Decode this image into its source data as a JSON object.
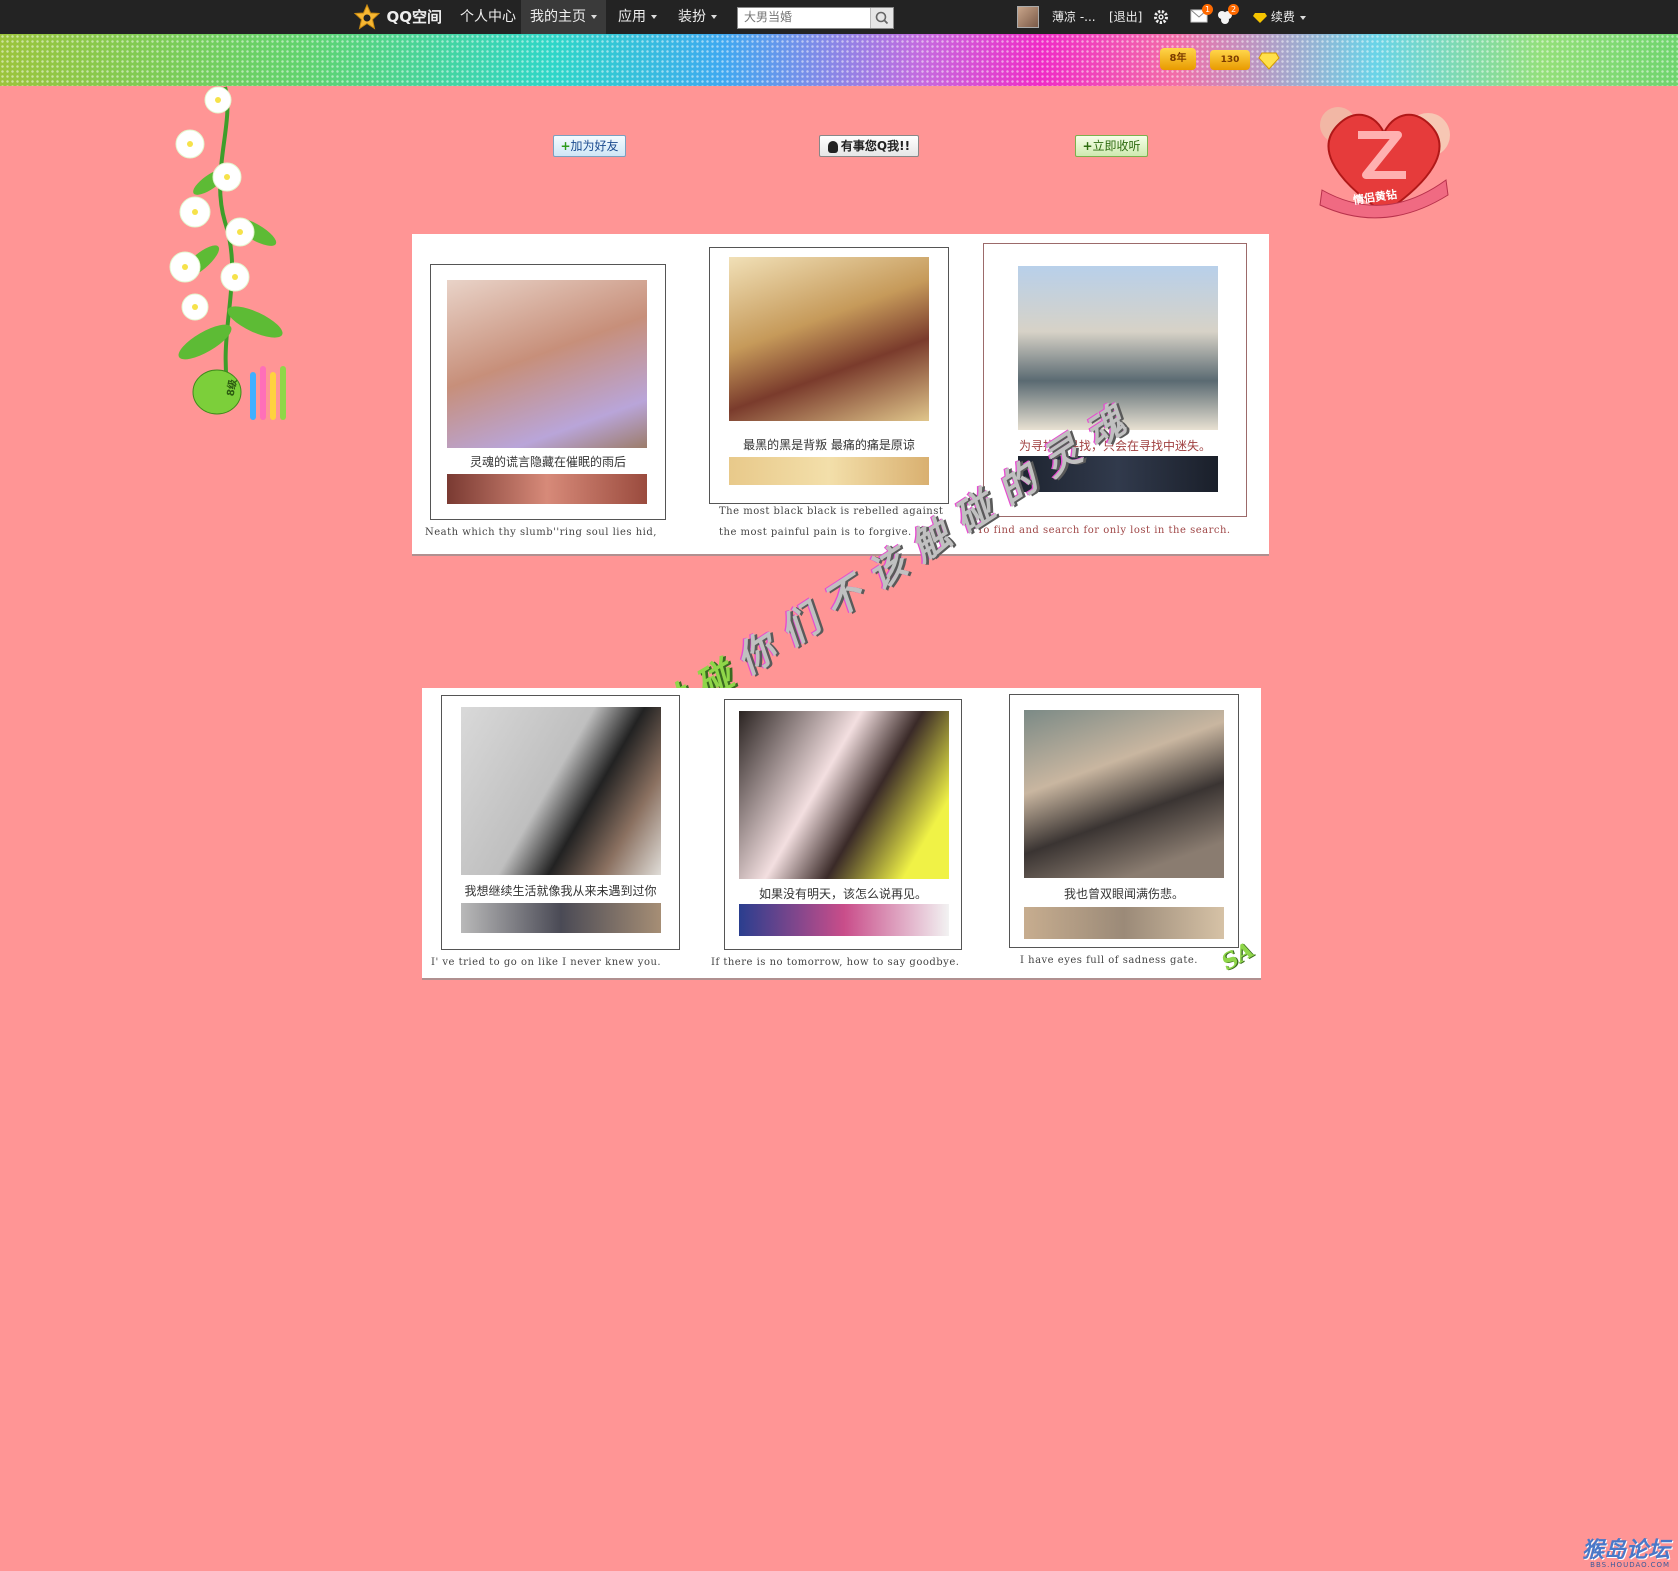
{
  "topbar": {
    "logo": "QQ空间",
    "nav": [
      {
        "label": "个人中心"
      },
      {
        "label": "我的主页"
      },
      {
        "label": "应用"
      },
      {
        "label": "装扮"
      }
    ],
    "search_placeholder": "大男当婚",
    "username": "薄凉 -...",
    "logout": "[退出]",
    "mail_count": "1",
    "friends_count": "2",
    "vip_label": "续费"
  },
  "banner": {
    "badges": [
      "8年",
      "130"
    ]
  },
  "actions": {
    "add_friend": "加为好友",
    "qq_me": "有事您Q我!!",
    "listen": "立即收听"
  },
  "heart_badge": "情侣黄钻",
  "vase_level": "8级",
  "deco_line_1": "你们不该触碰的灵魂",
  "deco_line_2": "别触碰",
  "deco_line_3": "SA",
  "row1": [
    {
      "caption": "灵魂的谎言隐藏在催眠的雨后",
      "english": "Neath which thy slumb''ring soul lies hid,"
    },
    {
      "caption": "最黑的黑是背叛 最痛的痛是原谅",
      "english_a": "The most black black is rebelled against",
      "english_b": "the most painful pain is to forgive."
    },
    {
      "caption": "为寻找而寻找，只会在寻找中迷失。",
      "english": "To find and search for only lost in the search."
    }
  ],
  "row2": [
    {
      "caption": "我想继续生活就像我从来未遇到过你",
      "english": "I' ve tried to go on like I never knew you."
    },
    {
      "caption": "如果没有明天，该怎么说再见。",
      "english": "If there is no tomorrow, how to say goodbye."
    },
    {
      "caption": "我也曾双眼闻满伤悲。",
      "english": "I have eyes full of sadness gate."
    }
  ],
  "watermark": "猴岛论坛",
  "watermark_url": "BBS.HOUDAO.COM"
}
